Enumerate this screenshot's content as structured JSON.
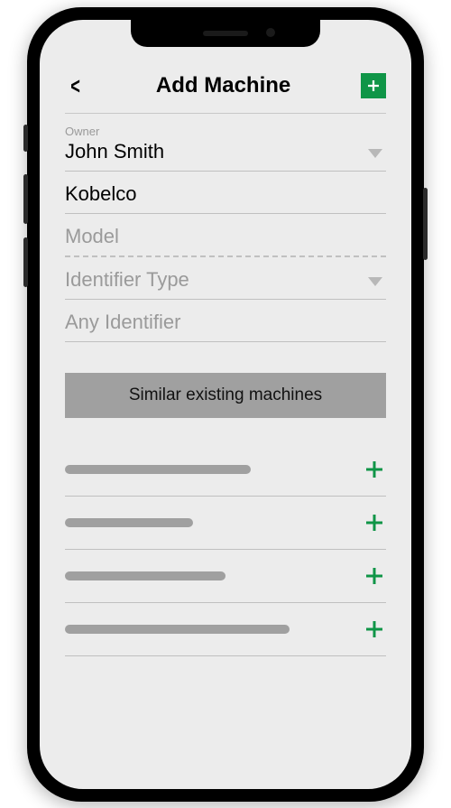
{
  "header": {
    "title": "Add Machine"
  },
  "fields": {
    "owner": {
      "label": "Owner",
      "value": "John Smith"
    },
    "brand": {
      "value": "Kobelco"
    },
    "model": {
      "placeholder": "Model"
    },
    "identifier_type": {
      "placeholder": "Identifier Type"
    },
    "any_identifier": {
      "placeholder": "Any Identifier"
    }
  },
  "section": {
    "similar_label": "Similar existing machines"
  },
  "accent_color": "#0f9547"
}
